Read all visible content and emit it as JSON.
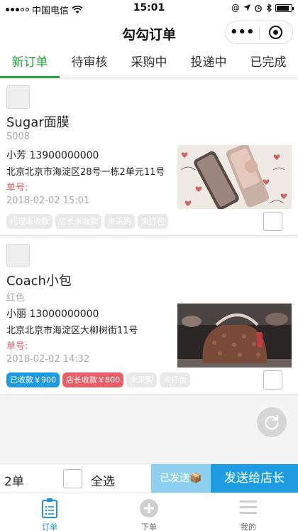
{
  "status_bar": {
    "carrier": "中国电信",
    "time": "15:01"
  },
  "nav": {
    "title": "勾勾订单",
    "more": "•••"
  },
  "tabs": [
    {
      "label": "新订单",
      "active": true
    },
    {
      "label": "待审核"
    },
    {
      "label": "采购中"
    },
    {
      "label": "投递中"
    },
    {
      "label": "已完成"
    }
  ],
  "orders": [
    {
      "name": "Sugar面膜",
      "spec": "S008",
      "contact": "小芳 13900000000",
      "address": "北京北京市海淀区28号一栋2单元11号",
      "order_no_label": "单号:",
      "date": "2018-02-02 15:01",
      "tags": [
        {
          "label": "代理未收款",
          "style": "gray"
        },
        {
          "label": "店长未收款",
          "style": "gray"
        },
        {
          "label": "未采购",
          "style": "gray"
        },
        {
          "label": "未打包",
          "style": "gray"
        }
      ]
    },
    {
      "name": "Coach小包",
      "spec": "红色",
      "contact": "小丽 13000000000",
      "address": "北京北京市海淀区大柳树街11号",
      "order_no_label": "单号:",
      "date": "2018-02-02 14:32",
      "tags": [
        {
          "label": "已收款￥900",
          "style": "blue"
        },
        {
          "label": "店长收款￥800",
          "style": "red"
        },
        {
          "label": "未采购",
          "style": "gray"
        },
        {
          "label": "未打包",
          "style": "gray"
        }
      ]
    }
  ],
  "footer": {
    "count": "2单",
    "select_all": "全选",
    "sent": "已发送📦",
    "send_to_manager": "发送给店长"
  },
  "tabbar": [
    {
      "label": "订单",
      "icon": "clipboard-icon",
      "active": true
    },
    {
      "label": "下单",
      "icon": "plus-circle-icon"
    },
    {
      "label": "我的",
      "icon": "menu-lines-icon"
    }
  ],
  "colors": {
    "accent_green": "#20a53a",
    "accent_blue": "#1f9de2",
    "paid_blue": "#1e9ae0",
    "manager_red": "#e85f66"
  }
}
